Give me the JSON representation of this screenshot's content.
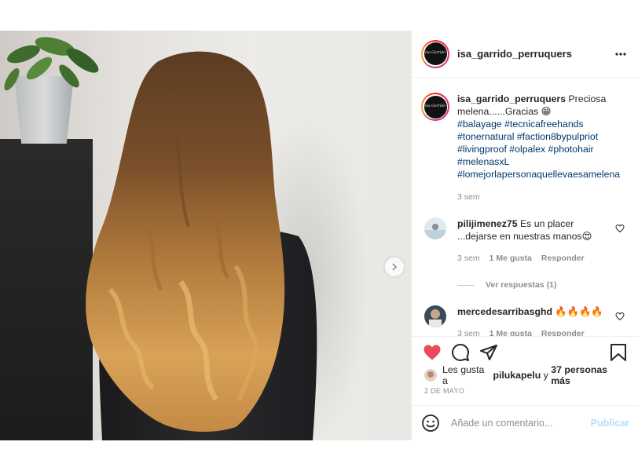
{
  "post": {
    "username": "isa_garrido_perruquers",
    "avatar_logo_text": "Isa Garrido",
    "more_icon": "more-horizontal-icon",
    "media": {
      "slide_count": 3,
      "active_slide": 1,
      "next_icon": "chevron-right-icon"
    },
    "caption": {
      "username": "isa_garrido_perruquers",
      "text": "Preciosa melena......Gracias 😁",
      "hashtags": [
        "#balayage #tecnicafreehands",
        "#tonernatural #faction8bypulpriot",
        "#livingproof #olpalex #photohair",
        "#melenasxL",
        "#lomejorlapersonaquellevaesamelena"
      ],
      "time": "3 sem"
    },
    "comments": [
      {
        "username": "pilijimenez75",
        "text": "Es un placer ...dejarse en nuestras manos😍",
        "time": "3 sem",
        "likes": "1 Me gusta",
        "reply": "Responder",
        "view_replies": "Ver respuestas (1)"
      },
      {
        "username": "mercedesarribasghd",
        "text": "🔥🔥🔥🔥",
        "time": "3 sem",
        "likes": "1 Me gusta",
        "reply": "Responder"
      }
    ],
    "actions": {
      "like_icon": "heart-filled-icon",
      "comment_icon": "comment-icon",
      "share_icon": "share-icon",
      "save_icon": "bookmark-icon",
      "like_color": "#ed4956"
    },
    "likes": {
      "prefix": "Les gusta a",
      "user": "pilukapelu",
      "connector": "y",
      "others": "37 personas más"
    },
    "date": "2 DE MAYO",
    "add_comment": {
      "placeholder": "Añade un comentario...",
      "post_label": "Publicar"
    }
  }
}
